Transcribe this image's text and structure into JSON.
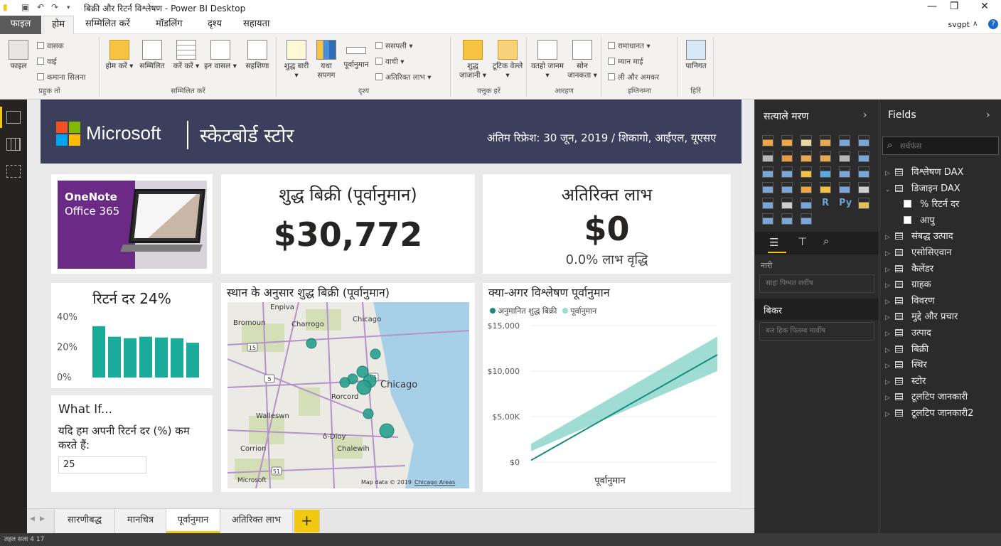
{
  "app": {
    "title": "बिक्री और रिटर्न विश्लेषण - Power BI Desktop",
    "user": "svgpt"
  },
  "menu": {
    "tabs": [
      "फाइल",
      "होम",
      "सम्मिलित करें",
      "मॉडलिंग",
      "दृश्य",
      "सहायता"
    ]
  },
  "ribbon": {
    "clipboard": {
      "paste": "फाइल",
      "cut": "वासक",
      "copy": "वाई",
      "format": "कमाना सिलना",
      "label": "प्रहुक तों"
    },
    "data": {
      "b1": "होम करें ▾",
      "b2": "सम्मिलित",
      "b3": "करें करें ▾",
      "b4": "इन वासल ▾",
      "b5": "सहशिणा",
      "label": "सम्मिलित करें"
    },
    "visuals": {
      "b1": "शुद्ध बारी ▾",
      "b2": "यथा सपगग",
      "b3": "पूर्वानुमान",
      "s1": "ससपली ▾",
      "s2": "वाची ▾",
      "s3": "अतिरिक्त लाभ ▾",
      "label": "दृश्य"
    },
    "insert": {
      "b1": "शुद्ध जाजानी ▾",
      "b2": "टूटिक वेल्ले ▾",
      "label": "वत्तुक हरें"
    },
    "share": {
      "b1": "वतहो जानम ▾",
      "b2": "सोन जानकता ▾",
      "label": "आरहण"
    },
    "relations": {
      "s1": "रामाधानत ▾",
      "s2": "म्यान माई",
      "s3": "ली और अमकर",
      "label": "इग्तिनम्ना"
    },
    "publish": {
      "b1": "पानिगत",
      "label": "हिरिं"
    }
  },
  "report": {
    "brand": "Microsoft",
    "store": "स्केटबोर्ड स्टोर",
    "refresh": "अंतिम रिफ्रेश: 30 जून, 2019 / शिकागो, आईएल, यूएसए",
    "promo": {
      "line1": "OneNote",
      "line2": "Office 365"
    },
    "kpi_sales": {
      "title": "शुद्ध बिक्री (पूर्वानुमान)",
      "value": "$30,772"
    },
    "kpi_profit": {
      "title": "अतिरिक्त लाभ",
      "value": "$0",
      "sub": "0.0% लाभ वृद्धि"
    },
    "return_card": {
      "title": "रिटर्न दर 24%"
    },
    "whatif": {
      "title": "What If...",
      "question": "यदि हम अपनी रिटर्न दर (%) कम करते हैं:",
      "value": "25"
    },
    "map": {
      "title": "स्थान के अनुसार शुद्ध बिक्री (पूर्वानुमान)",
      "places": [
        "Enpiva",
        "Bromoun",
        "Charrogo",
        "Chicago",
        "Chicago",
        "Rorcord",
        "Walleswn",
        "ô-Dioy",
        "Corrion",
        "Chalewih"
      ],
      "roads": [
        "15",
        "5",
        "55",
        "51"
      ],
      "credit": "Map data © 2019 ",
      "credit_link": "Chicago Areas",
      "logo": "Microsoft"
    },
    "forecast": {
      "title": "क्या-अगर विश्लेषण पूर्वानुमान",
      "legend": [
        "अनुमानित शुद्ध बिक्री",
        "पूर्वानुमान"
      ]
    }
  },
  "chart_data": [
    {
      "type": "bar",
      "title": "",
      "categories": [
        "1",
        "2",
        "3",
        "4",
        "5",
        "6",
        "7"
      ],
      "values": [
        0.34,
        0.27,
        0.26,
        0.27,
        0.265,
        0.26,
        0.23
      ],
      "yticks": [
        "40%",
        "20%",
        "0%"
      ],
      "ylim": [
        0,
        0.45
      ],
      "color": "#1aab9b"
    },
    {
      "type": "line",
      "xlabel": "पूर्वानुमान",
      "yticks": [
        "$15,000",
        "$10,000",
        "$5,00K",
        "$0"
      ],
      "ylim": [
        0,
        15000
      ],
      "x": [
        0,
        1
      ],
      "series": [
        {
          "name": "अनुमानित शुद्ध बिक्री",
          "values": [
            200,
            11800
          ],
          "color": "#138c7e"
        },
        {
          "name": "पूर्वानुमान",
          "lower": [
            1200,
            10000
          ],
          "upper": [
            2000,
            13800
          ],
          "color": "#7fd1c6"
        }
      ]
    }
  ],
  "pages": {
    "tabs": [
      "सारणीबद्ध",
      "मानचित्र",
      "पूर्वानुमान",
      "अतिरिक्त लाभ"
    ],
    "add": "+"
  },
  "status": {
    "text": "तहल सला 4 17"
  },
  "viz": {
    "title": "सत्याले मरण",
    "values_label": "नारी",
    "values_placeholder": "साहः पिग्मत शर्वीष",
    "filters_label": "बिकर",
    "filters_placeholder": "बल हिक पिलम्ब मार्वीष"
  },
  "fields": {
    "title": "Fields",
    "search_placeholder": "सर्चफंस",
    "items": [
      {
        "name": "विश्लेषण DAX",
        "kind": "table",
        "expanded": false
      },
      {
        "name": "डिजाइन DAX",
        "kind": "table",
        "expanded": true
      },
      {
        "name": "% रिटर्न दर",
        "kind": "field"
      },
      {
        "name": "आपु",
        "kind": "field"
      },
      {
        "name": "संबद्ध उत्पाद",
        "kind": "table",
        "expanded": false
      },
      {
        "name": "एसोसिएवान",
        "kind": "table",
        "expanded": false
      },
      {
        "name": "कैलेंडर",
        "kind": "table",
        "expanded": false
      },
      {
        "name": "ग्राहक",
        "kind": "table",
        "expanded": false
      },
      {
        "name": "विवरण",
        "kind": "table",
        "expanded": false
      },
      {
        "name": "मुद्दे और प्रचार",
        "kind": "table",
        "expanded": false
      },
      {
        "name": "उत्पाद",
        "kind": "table",
        "expanded": false
      },
      {
        "name": "बिक्री",
        "kind": "table",
        "expanded": false
      },
      {
        "name": "स्थिर",
        "kind": "table",
        "expanded": false
      },
      {
        "name": "स्टोर",
        "kind": "table",
        "expanded": false
      },
      {
        "name": "टूलटिप जानकारी",
        "kind": "table",
        "expanded": false
      },
      {
        "name": "टूलटिप जानकारी2",
        "kind": "table",
        "expanded": false
      }
    ]
  },
  "colors": {
    "accent": "#f2c811",
    "teal": "#1aab9b",
    "header": "#3b3f5c"
  }
}
